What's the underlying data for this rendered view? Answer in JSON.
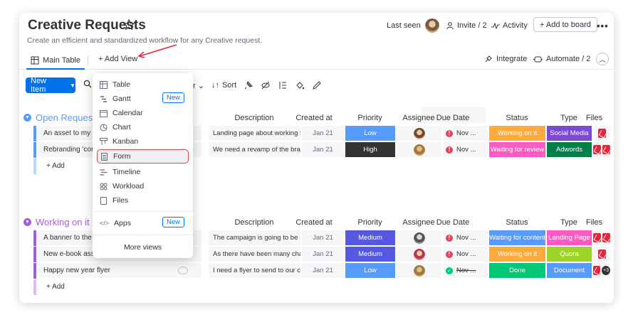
{
  "header": {
    "title": "Creative Requests",
    "subtitle": "Create an efficient and standardized workflow for any Creative request.",
    "last_seen": "Last seen",
    "invite": "Invite / 2",
    "activity": "Activity",
    "add_to_board": "+ Add to board",
    "more": "•••"
  },
  "tabs": {
    "main_table": "Main Table",
    "add_view": "+ Add View",
    "integrate": "Integrate",
    "automate": "Automate / 2"
  },
  "toolbar": {
    "new_item": "New Item",
    "filter_fragment": "r",
    "sort": "Sort"
  },
  "columns": [
    "Description",
    "Created at",
    "Priority",
    "Assignee",
    "Due Date",
    "Status",
    "Type",
    "Files"
  ],
  "groups": [
    {
      "title": "Open Requests",
      "color": "#579bfc",
      "rows": [
        {
          "name": "An asset to my lan",
          "description": "Landing page about working f...",
          "created": "Jan 21",
          "priority": "Low",
          "priority_color": "#579bfc",
          "due": "Nov ...",
          "status": "Working on it",
          "status_color": "#fdab3d",
          "type": "Social Media",
          "type_color": "#784bd1"
        },
        {
          "name": "Rebranding 'contac",
          "description": "We need a revamp of the bran...",
          "created": "Jan 21",
          "priority": "High",
          "priority_color": "#333333",
          "due": "Nov ...",
          "status": "Waiting for review",
          "status_color": "#ff5ac4",
          "type": "Adwords",
          "type_color": "#037f4c"
        }
      ],
      "add_label": "+ Add"
    },
    {
      "title": "Working on it",
      "color": "#a25ddc",
      "rows": [
        {
          "name": "A banner to the ne",
          "description": "The campaign is going to be ...",
          "created": "Jan 21",
          "priority": "Medium",
          "priority_color": "#5559df",
          "due": "Nov ...",
          "status": "Waiting for content",
          "status_color": "#579bfc",
          "type": "Landing Page",
          "type_color": "#ff5ac4"
        },
        {
          "name": "New e-book assets",
          "description": "As there have been many cha...",
          "created": "Jan 21",
          "priority": "Medium",
          "priority_color": "#5559df",
          "due": "Nov ...",
          "status": "Working on it",
          "status_color": "#fdab3d",
          "type": "Quora",
          "type_color": "#9cd326"
        },
        {
          "name": "Happy new year flyer",
          "description": "I need a flyer to send to our c...",
          "created": "Jan 21",
          "priority": "Low",
          "priority_color": "#579bfc",
          "due": "Nov ...",
          "status": "Done",
          "status_color": "#00c875",
          "type": "Document",
          "type_color": "#579bfc",
          "files_extra": "+3"
        }
      ],
      "add_label": "+ Add"
    }
  ],
  "menu": {
    "items": [
      {
        "label": "Table"
      },
      {
        "label": "Gantt",
        "badge": "New"
      },
      {
        "label": "Calendar"
      },
      {
        "label": "Chart"
      },
      {
        "label": "Kanban"
      },
      {
        "label": "Form"
      },
      {
        "label": "Timeline"
      },
      {
        "label": "Workload"
      },
      {
        "label": "Files"
      }
    ],
    "apps": {
      "label": "Apps",
      "badge": "New"
    },
    "more_views": "More views"
  },
  "colors": {
    "primary": "#0073ea",
    "highlight": "#e2443c"
  }
}
